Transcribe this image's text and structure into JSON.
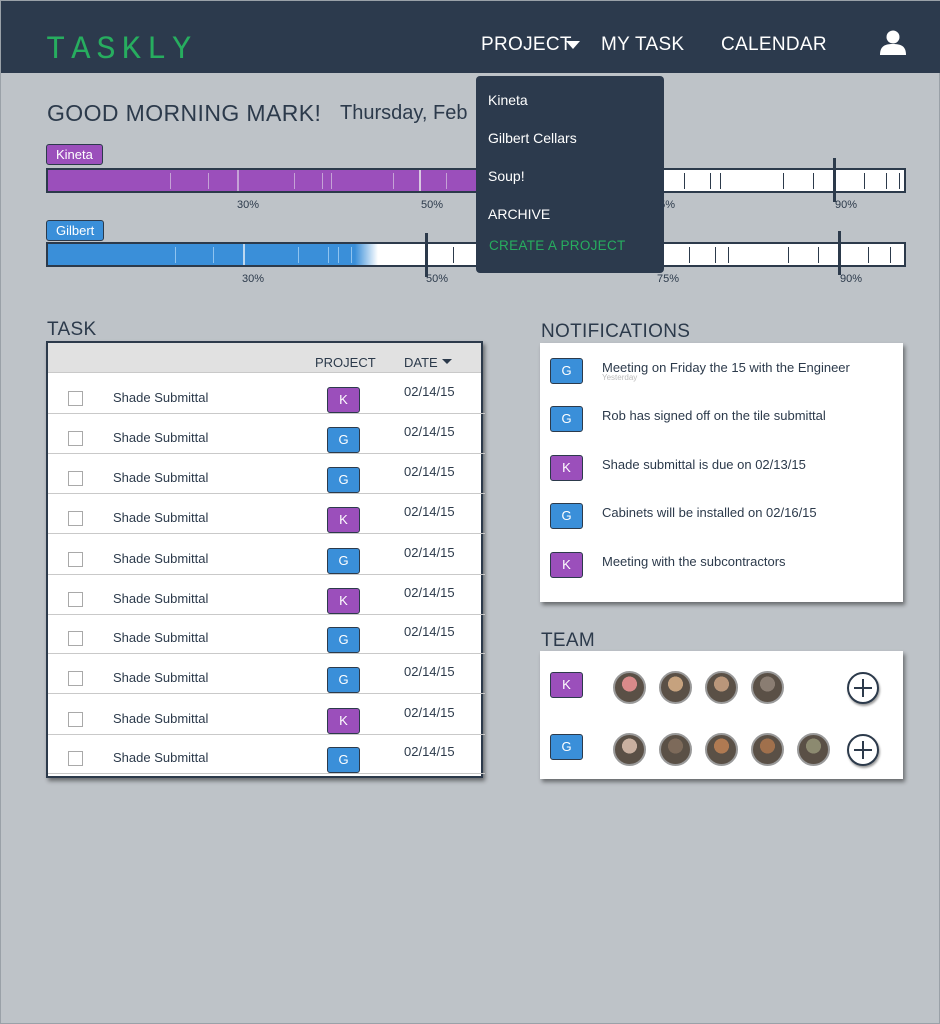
{
  "header": {
    "logo": "TASKLY",
    "nav": {
      "project": "PROJECT",
      "my_task": "MY TASK",
      "calendar": "CALENDAR"
    },
    "user_icon": "user-icon"
  },
  "greeting": "GOOD MORNING MARK!",
  "date": "Thursday, Feb",
  "projects_progress": [
    {
      "name": "Kineta",
      "color": "#9b4fbb",
      "progress": 0.5,
      "markers": [
        "30%",
        "50%",
        "75%",
        "90%"
      ]
    },
    {
      "name": "Gilbert",
      "color": "#3a8fd9",
      "progress": 0.38,
      "markers": [
        "30%",
        "50%",
        "75%",
        "90%"
      ]
    }
  ],
  "dropdown": {
    "items": [
      "Kineta",
      "Gilbert Cellars",
      "Soup!",
      "ARCHIVE"
    ],
    "create": "CREATE A PROJECT"
  },
  "task": {
    "title": "TASK",
    "columns": {
      "project": "PROJECT",
      "date": "DATE"
    },
    "rows": [
      {
        "name": "Shade Submittal",
        "project": "K",
        "date": "02/14/15"
      },
      {
        "name": "Shade Submittal",
        "project": "G",
        "date": "02/14/15"
      },
      {
        "name": "Shade Submittal",
        "project": "G",
        "date": "02/14/15"
      },
      {
        "name": "Shade Submittal",
        "project": "K",
        "date": "02/14/15"
      },
      {
        "name": "Shade Submittal",
        "project": "G",
        "date": "02/14/15"
      },
      {
        "name": "Shade Submittal",
        "project": "K",
        "date": "02/14/15"
      },
      {
        "name": "Shade Submittal",
        "project": "G",
        "date": "02/14/15"
      },
      {
        "name": "Shade Submittal",
        "project": "G",
        "date": "02/14/15"
      },
      {
        "name": "Shade Submittal",
        "project": "K",
        "date": "02/14/15"
      },
      {
        "name": "Shade Submittal",
        "project": "G",
        "date": "02/14/15"
      }
    ]
  },
  "notifications": {
    "title": "NOTIFICATIONS",
    "items": [
      {
        "project": "G",
        "text": "Meeting on Friday the 15 with the Engineer",
        "sub": "Yesterday"
      },
      {
        "project": "G",
        "text": "Rob has signed off on the tile submittal",
        "sub": ""
      },
      {
        "project": "K",
        "text": "Shade submittal is due on 02/13/15",
        "sub": ""
      },
      {
        "project": "G",
        "text": "Cabinets will be installed on 02/16/15",
        "sub": ""
      },
      {
        "project": "K",
        "text": "Meeting with the subcontractors",
        "sub": ""
      }
    ]
  },
  "team": {
    "title": "TEAM",
    "rows": [
      {
        "project": "K",
        "members": [
          "#d98a8a",
          "#c6a27e",
          "#b9967a",
          "#8a7d72"
        ]
      },
      {
        "project": "G",
        "members": [
          "#c9b0a0",
          "#7d6a5a",
          "#b07a52",
          "#a0704c",
          "#8c8a70"
        ]
      }
    ]
  },
  "colors": {
    "header": "#2c3a4d",
    "accent": "#27ad5f",
    "kineta": "#9b4fbb",
    "gilbert": "#3a8fd9"
  }
}
